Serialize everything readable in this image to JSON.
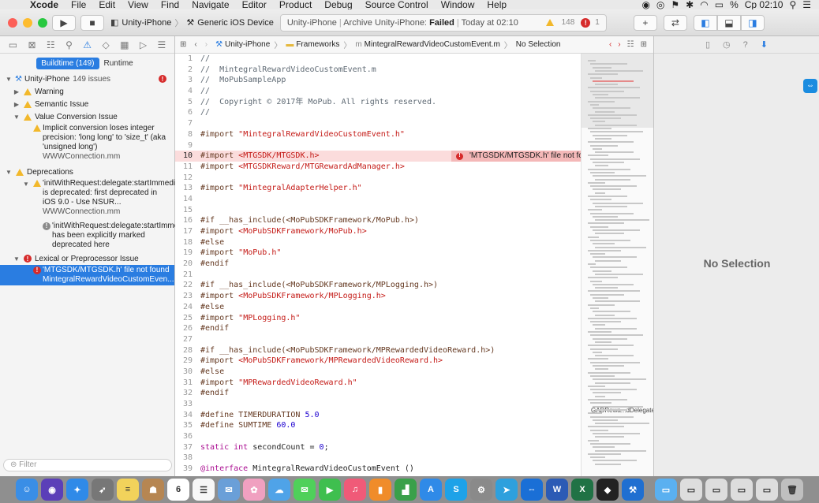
{
  "menubar": {
    "apple": "",
    "app": "Xcode",
    "items": [
      "File",
      "Edit",
      "View",
      "Find",
      "Navigate",
      "Editor",
      "Product",
      "Debug",
      "Source Control",
      "Window",
      "Help"
    ],
    "battery": "%",
    "clock": "Ср 02:10"
  },
  "toolbar": {
    "scheme": "Unity-iPhone",
    "destination": "Generic iOS Device",
    "activity_project": "Unity-iPhone",
    "activity_action": "Archive Unity-iPhone:",
    "activity_result": "Failed",
    "activity_time": "Today at 02:10",
    "warnings": "148",
    "errors": "1"
  },
  "navigator": {
    "segment_buildtime": "Buildtime (149)",
    "segment_runtime": "Runtime",
    "project_name": "Unity-iPhone",
    "project_count": "149 issues",
    "groups": {
      "warning": "Warning",
      "semantic": "Semantic Issue",
      "value_conversion": "Value Conversion Issue",
      "value_conversion_msg": "Implicit conversion loses integer precision: 'long long' to 'size_t' (aka 'unsigned long')",
      "value_conversion_file": "WWWConnection.mm",
      "deprecations": "Deprecations",
      "deprecation_msg": "'initWithRequest:delegate:startImmediately:' is deprecated: first deprecated in iOS 9.0 - Use NSUR...",
      "deprecation_file": "WWWConnection.mm",
      "deprecation_note": "'initWithRequest:delegate:startImmediately:' has been explicitly marked deprecated here",
      "lexical": "Lexical or Preprocessor Issue",
      "lexical_msg": "'MTGSDK/MTGSDK.h' file not found",
      "lexical_file": "MintegralRewardVideoCustomEven..."
    },
    "filter_placeholder": "Filter"
  },
  "jumpbar": {
    "project": "Unity-iPhone",
    "folder": "Frameworks",
    "file": "MintegralRewardVideoCustomEvent.m",
    "selection": "No Selection"
  },
  "editor": {
    "inline_error": "'MTGSDK/MTGSDK.h' file not found",
    "lines": [
      {
        "n": "1",
        "parts": [
          [
            "c-comment",
            "//"
          ]
        ]
      },
      {
        "n": "2",
        "parts": [
          [
            "c-comment",
            "//  MintegralRewardVideoCustomEvent.m"
          ]
        ]
      },
      {
        "n": "3",
        "parts": [
          [
            "c-comment",
            "//  MoPubSampleApp"
          ]
        ]
      },
      {
        "n": "4",
        "parts": [
          [
            "c-comment",
            "//"
          ]
        ]
      },
      {
        "n": "5",
        "parts": [
          [
            "c-comment",
            "//  Copyright © 2017年 MoPub. All rights reserved."
          ]
        ]
      },
      {
        "n": "6",
        "parts": [
          [
            "c-comment",
            "//"
          ]
        ]
      },
      {
        "n": "7",
        "parts": []
      },
      {
        "n": "8",
        "parts": [
          [
            "c-pre",
            "#import "
          ],
          [
            "c-str",
            "\"MintegralRewardVideoCustomEvent.h\""
          ]
        ]
      },
      {
        "n": "9",
        "parts": []
      },
      {
        "n": "10",
        "err": true,
        "parts": [
          [
            "c-pre",
            "#import "
          ],
          [
            "c-str",
            "<MTGSDK/MTGSDK.h>"
          ]
        ]
      },
      {
        "n": "11",
        "parts": [
          [
            "c-pre",
            "#import "
          ],
          [
            "c-str",
            "<MTGSDKReward/MTGRewardAdManager.h>"
          ]
        ]
      },
      {
        "n": "12",
        "parts": []
      },
      {
        "n": "13",
        "parts": [
          [
            "c-pre",
            "#import "
          ],
          [
            "c-str",
            "\"MintegralAdapterHelper.h\""
          ]
        ]
      },
      {
        "n": "14",
        "parts": []
      },
      {
        "n": "15",
        "parts": []
      },
      {
        "n": "16",
        "parts": [
          [
            "c-pre",
            "#if __has_include(<MoPubSDKFramework/MoPub.h>)"
          ]
        ]
      },
      {
        "n": "17",
        "parts": [
          [
            "c-pre",
            "#import "
          ],
          [
            "c-str",
            "<MoPubSDKFramework/MoPub.h>"
          ]
        ]
      },
      {
        "n": "18",
        "parts": [
          [
            "c-pre",
            "#else"
          ]
        ]
      },
      {
        "n": "19",
        "parts": [
          [
            "c-pre",
            "#import "
          ],
          [
            "c-str",
            "\"MoPub.h\""
          ]
        ]
      },
      {
        "n": "20",
        "parts": [
          [
            "c-pre",
            "#endif"
          ]
        ]
      },
      {
        "n": "21",
        "parts": []
      },
      {
        "n": "22",
        "parts": [
          [
            "c-pre",
            "#if __has_include(<MoPubSDKFramework/MPLogging.h>)"
          ]
        ]
      },
      {
        "n": "23",
        "parts": [
          [
            "c-pre",
            "#import "
          ],
          [
            "c-str",
            "<MoPubSDKFramework/MPLogging.h>"
          ]
        ]
      },
      {
        "n": "24",
        "parts": [
          [
            "c-pre",
            "#else"
          ]
        ]
      },
      {
        "n": "25",
        "parts": [
          [
            "c-pre",
            "#import "
          ],
          [
            "c-str",
            "\"MPLogging.h\""
          ]
        ]
      },
      {
        "n": "26",
        "parts": [
          [
            "c-pre",
            "#endif"
          ]
        ]
      },
      {
        "n": "27",
        "parts": []
      },
      {
        "n": "28",
        "parts": [
          [
            "c-pre",
            "#if __has_include(<MoPubSDKFramework/MPRewardedVideoReward.h>)"
          ]
        ]
      },
      {
        "n": "29",
        "parts": [
          [
            "c-pre",
            "#import "
          ],
          [
            "c-str",
            "<MoPubSDKFramework/MPRewardedVideoReward.h>"
          ]
        ]
      },
      {
        "n": "30",
        "parts": [
          [
            "c-pre",
            "#else"
          ]
        ]
      },
      {
        "n": "31",
        "parts": [
          [
            "c-pre",
            "#import "
          ],
          [
            "c-str",
            "\"MPRewardedVideoReward.h\""
          ]
        ]
      },
      {
        "n": "32",
        "parts": [
          [
            "c-pre",
            "#endif"
          ]
        ]
      },
      {
        "n": "33",
        "parts": []
      },
      {
        "n": "34",
        "parts": [
          [
            "c-pre",
            "#define TIMERDURATION "
          ],
          [
            "c-num",
            "5.0"
          ]
        ]
      },
      {
        "n": "35",
        "parts": [
          [
            "c-pre",
            "#define SUMTIME "
          ],
          [
            "c-num",
            "60.0"
          ]
        ]
      },
      {
        "n": "36",
        "parts": []
      },
      {
        "n": "37",
        "parts": [
          [
            "c-kw",
            "static int "
          ],
          [
            "c-plain",
            "secondCount = "
          ],
          [
            "c-num",
            "0"
          ],
          [
            "c-plain",
            ";"
          ]
        ]
      },
      {
        "n": "38",
        "parts": []
      },
      {
        "n": "39",
        "parts": [
          [
            "c-kw",
            "@interface "
          ],
          [
            "c-plain",
            "MintegralRewardVideoCustomEvent ()"
          ]
        ]
      }
    ]
  },
  "minimap": {
    "label": "GADRewa...dDelegate"
  },
  "inspector": {
    "empty_text": "No Selection"
  },
  "dock": {
    "items": [
      {
        "name": "finder-icon",
        "color": "#3a8ee6",
        "glyph": "☺"
      },
      {
        "name": "siri-icon",
        "color": "#5b3fb8",
        "glyph": "◉"
      },
      {
        "name": "safari-icon",
        "color": "#2f8ae8",
        "glyph": "✦"
      },
      {
        "name": "rocket-icon",
        "color": "#777777",
        "glyph": "➶"
      },
      {
        "name": "notes-icon",
        "color": "#f2d25b",
        "glyph": "≡"
      },
      {
        "name": "contacts-icon",
        "color": "#b68652",
        "glyph": "☗"
      },
      {
        "name": "calendar-icon",
        "color": "#ffffff",
        "glyph": "6"
      },
      {
        "name": "reminders-icon",
        "color": "#f7f7f7",
        "glyph": "☰"
      },
      {
        "name": "preview-icon",
        "color": "#6a9fd8",
        "glyph": "✉"
      },
      {
        "name": "photos-icon",
        "color": "#f0a0c0",
        "glyph": "✿"
      },
      {
        "name": "cloud-icon",
        "color": "#4fa3e8",
        "glyph": "☁"
      },
      {
        "name": "messages-icon",
        "color": "#4fd05a",
        "glyph": "✉"
      },
      {
        "name": "facetime-icon",
        "color": "#3fbf4f",
        "glyph": "▶"
      },
      {
        "name": "music-icon",
        "color": "#f05a78",
        "glyph": "♫"
      },
      {
        "name": "books-icon",
        "color": "#f08c2a",
        "glyph": "▮"
      },
      {
        "name": "numbers-icon",
        "color": "#3aa04a",
        "glyph": "▟"
      },
      {
        "name": "app-store-icon",
        "color": "#2f8ae8",
        "glyph": "A"
      },
      {
        "name": "skype-icon",
        "color": "#1da2e8",
        "glyph": "S"
      },
      {
        "name": "system-preferences-icon",
        "color": "#8a8a8a",
        "glyph": "⚙"
      },
      {
        "name": "telegram-icon",
        "color": "#2ea0dd",
        "glyph": "➤"
      },
      {
        "name": "teamviewer-icon",
        "color": "#1a6fd6",
        "glyph": "⇔"
      },
      {
        "name": "word-icon",
        "color": "#2b5bb5",
        "glyph": "W"
      },
      {
        "name": "excel-icon",
        "color": "#207245",
        "glyph": "X"
      },
      {
        "name": "unity-icon",
        "color": "#222222",
        "glyph": "◆"
      },
      {
        "name": "xcode-icon",
        "color": "#1f6fd1",
        "glyph": "⚒"
      },
      {
        "name": "folder-icon",
        "color": "#5ab0f0",
        "glyph": "▭"
      },
      {
        "name": "window-icon",
        "color": "#dddddd",
        "glyph": "▭"
      },
      {
        "name": "window-icon-2",
        "color": "#dddddd",
        "glyph": "▭"
      },
      {
        "name": "window-icon-3",
        "color": "#dddddd",
        "glyph": "▭"
      },
      {
        "name": "window-icon-4",
        "color": "#dddddd",
        "glyph": "▭"
      },
      {
        "name": "trash-icon",
        "color": "#bfbfbf",
        "glyph": "🗑"
      }
    ]
  }
}
